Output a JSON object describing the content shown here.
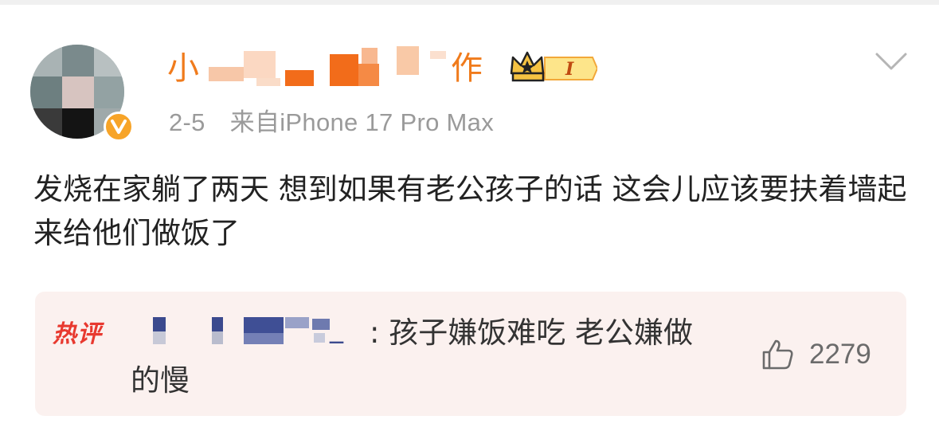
{
  "post": {
    "author": {
      "name_visible_fragments": [
        "小",
        "作"
      ],
      "badge_level": "I"
    },
    "meta": {
      "date": "2-5",
      "source": "来自iPhone 17 Pro Max"
    },
    "text": "发烧在家躺了两天 想到如果有老公孩子的话 这会儿应该要扶着墙起来给他们做饭了",
    "hot_comment": {
      "tag": "热评",
      "user_suffix": "_",
      "text": ": 孩子嫌饭难吃 老公嫌做的慢",
      "likes": "2279"
    }
  },
  "icons": {
    "verified": "verified-v-icon",
    "crown": "crown-icon",
    "menu": "chevron-down-icon",
    "like": "thumbs-up-icon"
  },
  "colors": {
    "username": "#f07b1c",
    "hot_tag": "#e8392f",
    "hot_bg": "#fbf1ef",
    "meta_text": "#9a9a9a",
    "verified": "#f7a428"
  }
}
